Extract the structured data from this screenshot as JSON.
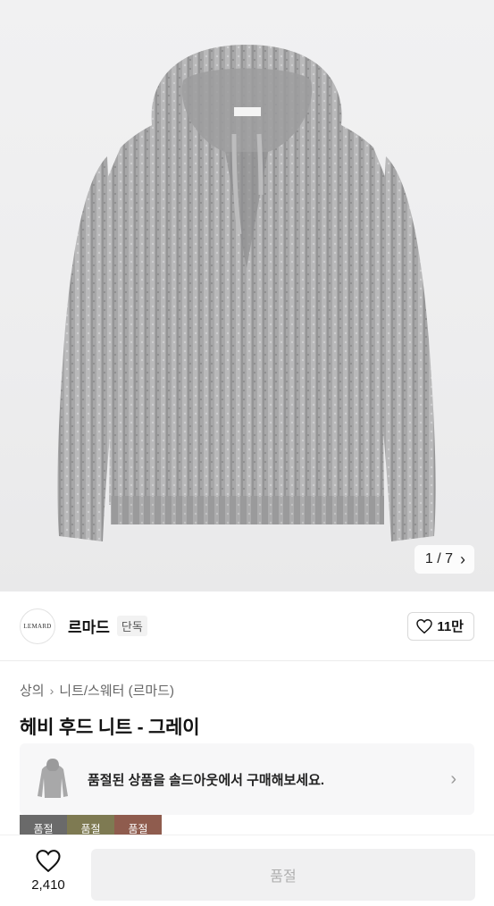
{
  "hero": {
    "image_icon": "gray-knit-hoodie-product-photo",
    "counter": "1 / 7",
    "next_icon": "chevron-right-icon"
  },
  "brand": {
    "logo_text": "LEMARD",
    "name": "르마드",
    "badge": "단독",
    "likes": "11만",
    "like_icon": "heart-outline-icon"
  },
  "breadcrumb": {
    "level1": "상의",
    "level2": "니트/스웨터 (르마드)",
    "separator_icon": "chevron-right-icon"
  },
  "product": {
    "title": "헤비 후드 니트 - 그레이"
  },
  "soldout_banner": {
    "text": "품절된 상품을 솔드아웃에서 구매해보세요.",
    "thumb_icon": "hoodie-thumbnail",
    "chevron_icon": "chevron-right-icon"
  },
  "swatches": [
    {
      "label": "품절",
      "color": "#6a6a6a"
    },
    {
      "label": "품절",
      "color": "#7e7a52"
    },
    {
      "label": "품절",
      "color": "#8f5c4e"
    }
  ],
  "bottom_bar": {
    "wish_count": "2,410",
    "wish_icon": "heart-outline-icon",
    "buy_label": "품절"
  },
  "colors": {
    "sweater_gray": "#a9a9aa",
    "disabled_button_bg": "#f0f0f1",
    "disabled_button_text": "#b0b0b0"
  }
}
